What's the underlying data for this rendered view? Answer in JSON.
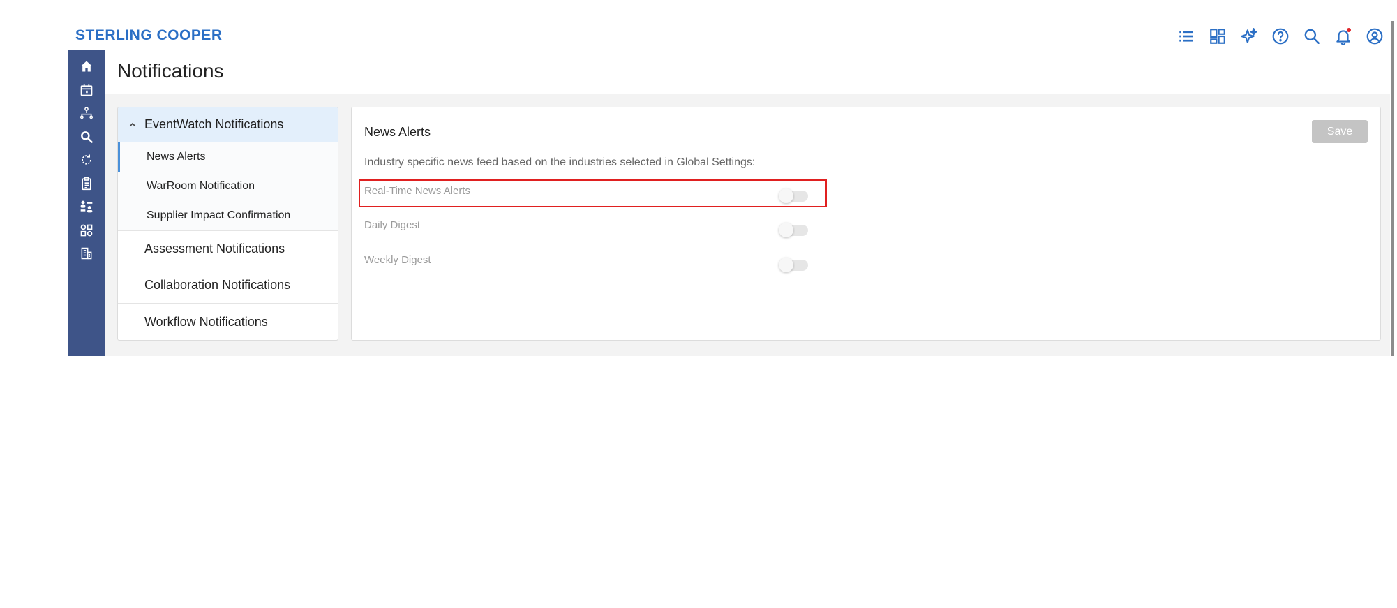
{
  "brand": {
    "name": "STERLING COOPER"
  },
  "topbar": {
    "icons": [
      "list-icon",
      "dashboard-icon",
      "ai-sparkle-icon",
      "help-icon",
      "search-icon",
      "bell-icon",
      "user-account-icon"
    ]
  },
  "sidebar": {
    "icons": [
      "home-icon",
      "calendar-icon",
      "network-icon",
      "search-icon",
      "refresh-icon",
      "clipboard-icon",
      "org-chart-icon",
      "apps-icon",
      "building-icon"
    ]
  },
  "page": {
    "title": "Notifications"
  },
  "nav": {
    "group_eventwatch": "EventWatch Notifications",
    "items": [
      {
        "label": "News Alerts"
      },
      {
        "label": "WarRoom Notification"
      },
      {
        "label": "Supplier Impact Confirmation"
      }
    ],
    "group_assessment": "Assessment Notifications",
    "group_collaboration": "Collaboration Notifications",
    "group_workflow": "Workflow Notifications"
  },
  "panel": {
    "title": "News Alerts",
    "save_label": "Save",
    "description": "Industry specific news feed based on the industries selected in Global Settings:",
    "settings": [
      {
        "label": "Real-Time News Alerts",
        "enabled": false
      },
      {
        "label": "Daily Digest",
        "enabled": false
      },
      {
        "label": "Weekly Digest",
        "enabled": false
      }
    ]
  },
  "colors": {
    "brand": "#2b6fc5",
    "sidebar": "#3e5488",
    "active_nav": "#e3effb",
    "highlight": "#e02020"
  }
}
